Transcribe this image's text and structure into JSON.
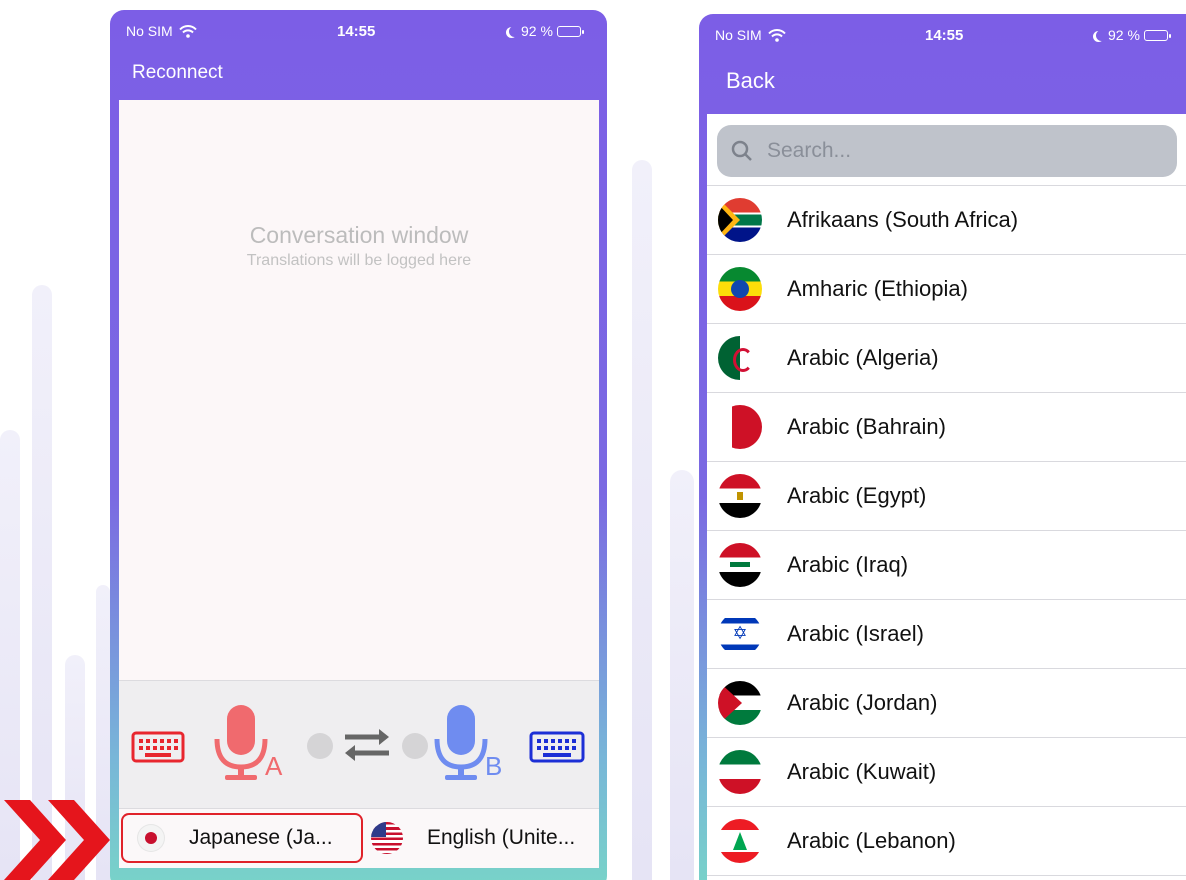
{
  "colors": {
    "header_purple": "#7c5ee6",
    "mic_a": "#f06a6e",
    "mic_b": "#6f8cf0",
    "keyboard_a": "#e8262e",
    "keyboard_b": "#1c2fd6",
    "selection_border": "#e0222a"
  },
  "left_screen": {
    "status": {
      "carrier": "No SIM",
      "time": "14:55",
      "battery": "92 %"
    },
    "nav": {
      "reconnect_label": "Reconnect"
    },
    "conversation": {
      "title": "Conversation window",
      "subtitle": "Translations will be logged here"
    },
    "controls": {
      "mic_a_letter": "A",
      "mic_b_letter": "B",
      "icons": [
        "keyboard-icon",
        "microphone-icon",
        "swap-arrows-icon",
        "microphone-icon",
        "keyboard-icon"
      ]
    },
    "languages": {
      "a": {
        "label": "Japanese (Ja...",
        "flag": "japan-flag-icon"
      },
      "b": {
        "label": "English (Unite...",
        "flag": "usa-flag-icon"
      }
    }
  },
  "right_screen": {
    "status": {
      "carrier": "No SIM",
      "time": "14:55",
      "battery": "92 %"
    },
    "nav": {
      "back_label": "Back"
    },
    "search": {
      "placeholder": "Search..."
    },
    "languages": [
      {
        "name": "Afrikaans (South Africa)",
        "flag": "south-africa"
      },
      {
        "name": "Amharic (Ethiopia)",
        "flag": "ethiopia"
      },
      {
        "name": "Arabic (Algeria)",
        "flag": "algeria"
      },
      {
        "name": "Arabic (Bahrain)",
        "flag": "bahrain"
      },
      {
        "name": "Arabic (Egypt)",
        "flag": "egypt"
      },
      {
        "name": "Arabic (Iraq)",
        "flag": "iraq"
      },
      {
        "name": "Arabic (Israel)",
        "flag": "israel"
      },
      {
        "name": "Arabic (Jordan)",
        "flag": "jordan"
      },
      {
        "name": "Arabic (Kuwait)",
        "flag": "kuwait"
      },
      {
        "name": "Arabic (Lebanon)",
        "flag": "lebanon"
      }
    ]
  }
}
